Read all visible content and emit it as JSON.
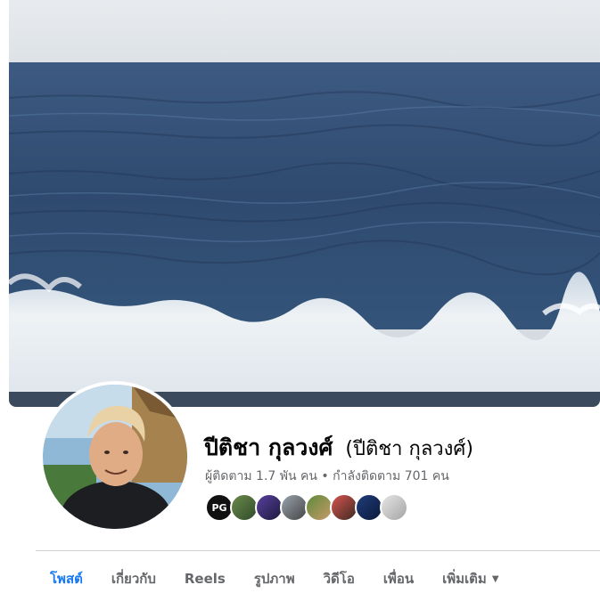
{
  "profile": {
    "name": "ปีติชา กุลวงศ์",
    "alternate_name": "(ปีติชา กุลวงศ์)",
    "followers_label": "ผู้ติดตาม",
    "followers_count": "1.7 พัน",
    "followers_unit": "คน",
    "separator": "•",
    "following_label": "กำลังติดตาม",
    "following_count": "701",
    "following_unit": "คน"
  },
  "friends": {
    "first_badge_text": "PG",
    "icons": [
      "pg-logo-avatar",
      "friend-avatar",
      "friend-avatar",
      "friend-avatar",
      "friend-avatar",
      "friend-avatar",
      "friend-avatar",
      "friend-avatar"
    ]
  },
  "tabs": [
    {
      "label": "โพสต์",
      "active": true
    },
    {
      "label": "เกี่ยวกับ",
      "active": false
    },
    {
      "label": "Reels",
      "active": false
    },
    {
      "label": "รูปภาพ",
      "active": false
    },
    {
      "label": "วิดีโอ",
      "active": false
    },
    {
      "label": "เพื่อน",
      "active": false
    },
    {
      "label": "เพิ่มเติม",
      "active": false
    }
  ],
  "colors": {
    "accent": "#1877f2",
    "text_primary": "#050505",
    "text_secondary": "#65676b",
    "sea": "#2f4a6e",
    "foam": "#eef2f5"
  }
}
